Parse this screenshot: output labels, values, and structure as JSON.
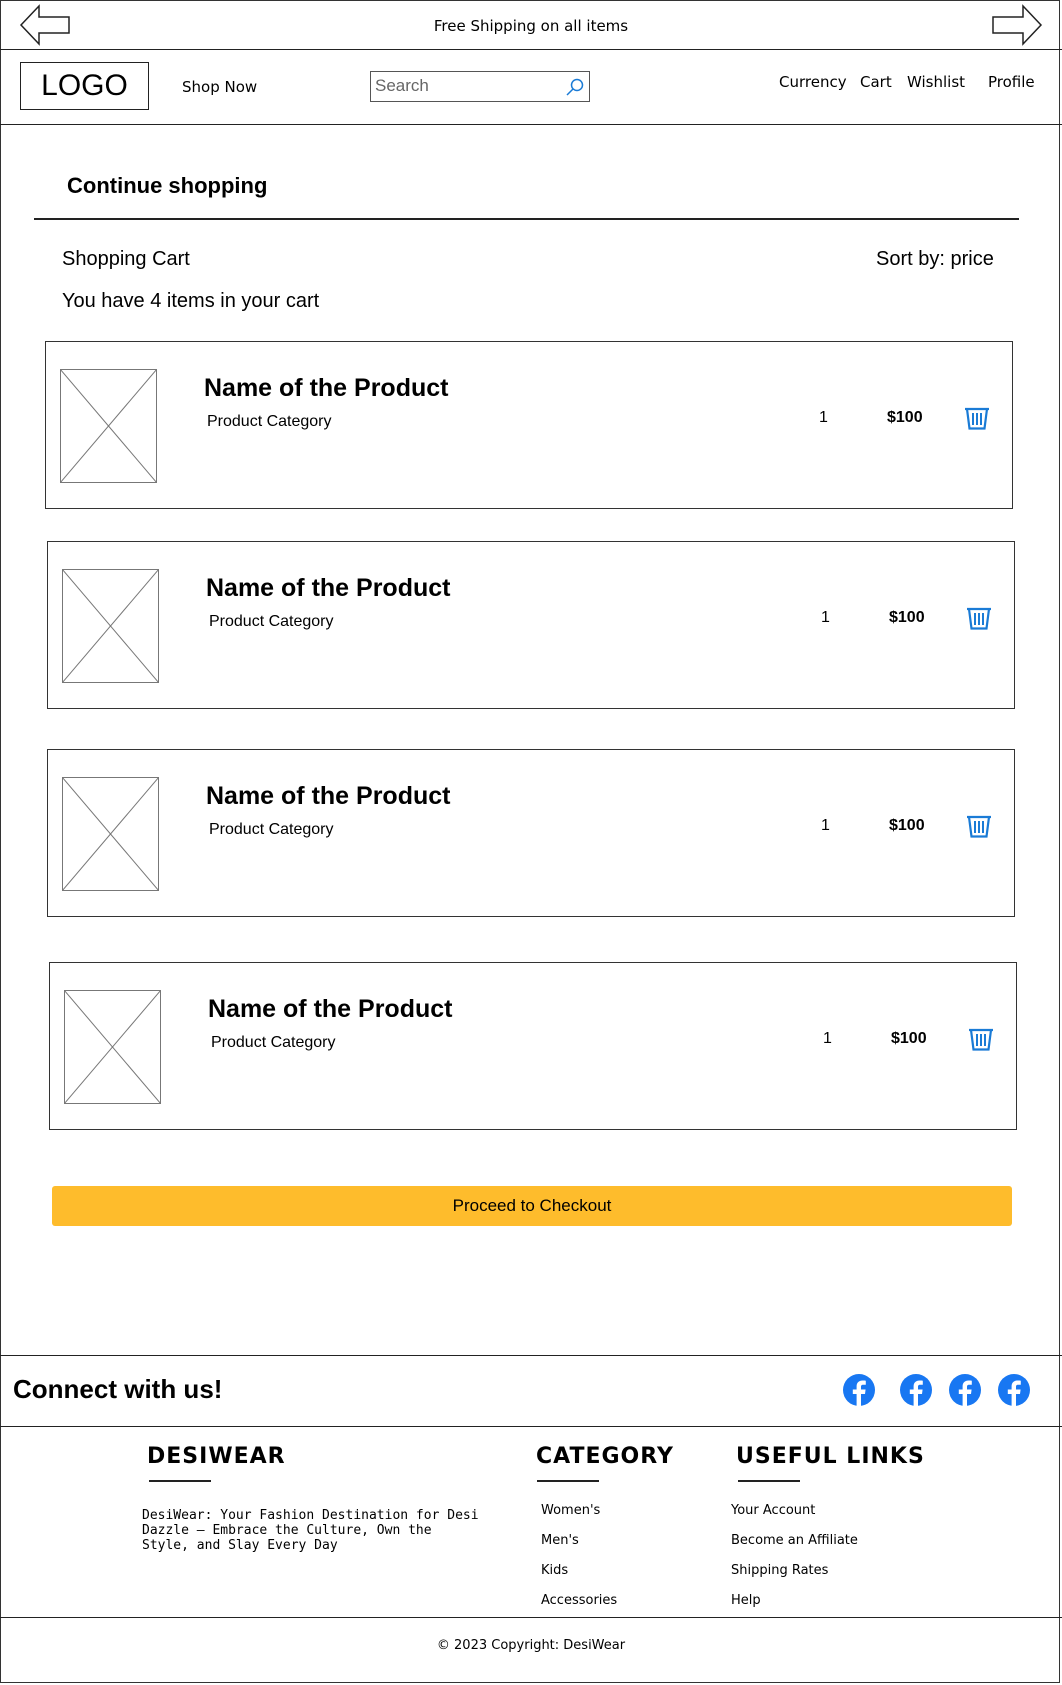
{
  "banner": {
    "text": "Free Shipping on all items"
  },
  "header": {
    "logo": "LOGO",
    "shop_now": "Shop Now",
    "search_placeholder": "Search",
    "nav": {
      "currency": "Currency",
      "cart": "Cart",
      "wishlist": "Wishlist",
      "profile": "Profile"
    }
  },
  "main": {
    "continue_shopping": "Continue shopping",
    "cart_title": "Shopping Cart",
    "sort_by": "Sort by: price",
    "cart_count": "You have 4 items in your cart",
    "items": [
      {
        "name": "Name of the Product",
        "category": "Product Category",
        "quantity": "1",
        "price": "$100"
      },
      {
        "name": "Name of the Product",
        "category": "Product Category",
        "quantity": "1",
        "price": "$100"
      },
      {
        "name": "Name of the Product",
        "category": "Product Category",
        "quantity": "1",
        "price": "$100"
      },
      {
        "name": "Name of the Product",
        "category": "Product Category",
        "quantity": "1",
        "price": "$100"
      }
    ],
    "checkout_label": "Proceed to Checkout"
  },
  "connect": {
    "title": "Connect with us!",
    "icons": [
      "facebook-icon",
      "facebook-icon",
      "facebook-icon",
      "facebook-icon"
    ]
  },
  "footer": {
    "brand": "DESIWEAR",
    "brand_desc": "DesiWear: Your Fashion Destination for Desi Dazzle – Embrace the Culture, Own the Style, and Slay Every Day",
    "category_title": "CATEGORY",
    "categories": [
      "Women's",
      "Men's",
      "Kids",
      "Accessories"
    ],
    "useful_title": "USEFUL LINKS",
    "useful_links": [
      "Your Account",
      "Become an Affiliate",
      "Shipping Rates",
      "Help"
    ],
    "copyright": "© 2023 Copyright: DesiWear"
  },
  "colors": {
    "accent": "#FEBC2C",
    "icon_blue": "#1A7BD6",
    "facebook": "#1877F2"
  }
}
